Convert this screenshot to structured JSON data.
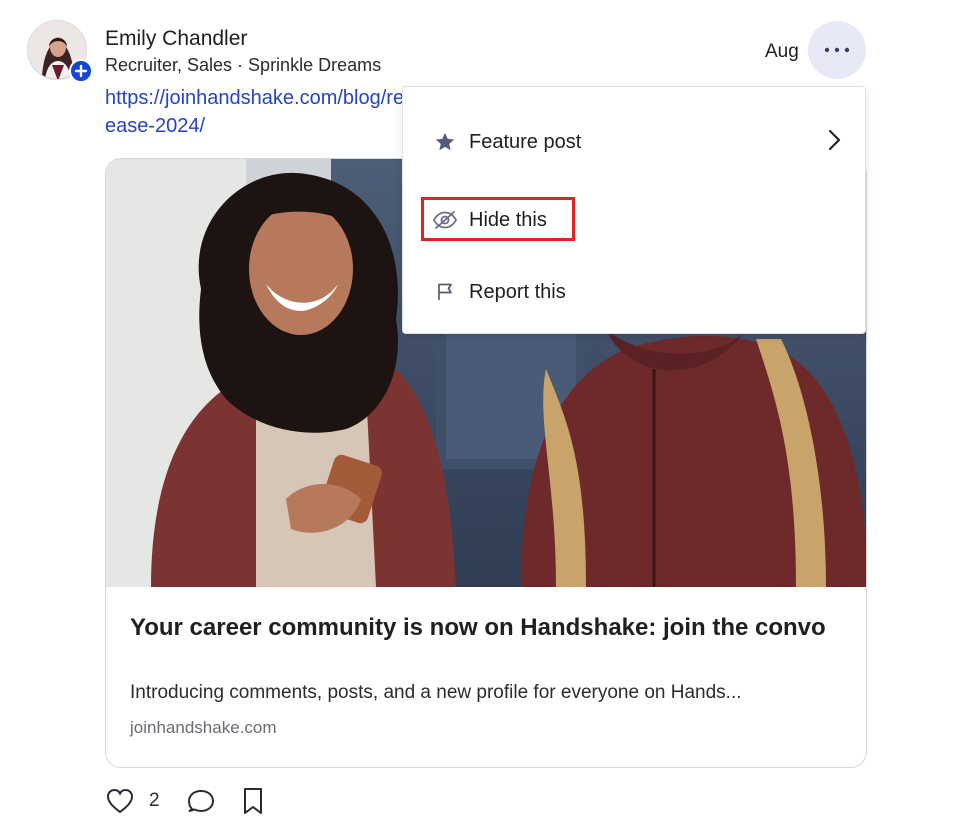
{
  "post": {
    "author_name": "Emily Chandler",
    "author_subtitle": "Recruiter, Sales · Sprinkle Dreams",
    "date": "Aug",
    "link_text": "https://joinhandshake.com/blog/release-2024/",
    "like_count": "2"
  },
  "card": {
    "title": "Your career community is now on Handshake: join the convo",
    "description": "Introducing comments, posts, and a new profile for everyone on Hands...",
    "domain": "joinhandshake.com"
  },
  "menu": {
    "items": [
      {
        "label": "Feature post",
        "icon": "star-icon",
        "has_submenu": true
      },
      {
        "label": "Hide this",
        "icon": "eye-slash-icon",
        "highlighted": true
      },
      {
        "label": "Report this",
        "icon": "flag-icon"
      }
    ]
  },
  "colors": {
    "link": "#2443c8",
    "more_button_bg": "#e7e9f7",
    "avatar_badge": "#1346d6",
    "highlight": "#e4231d"
  }
}
